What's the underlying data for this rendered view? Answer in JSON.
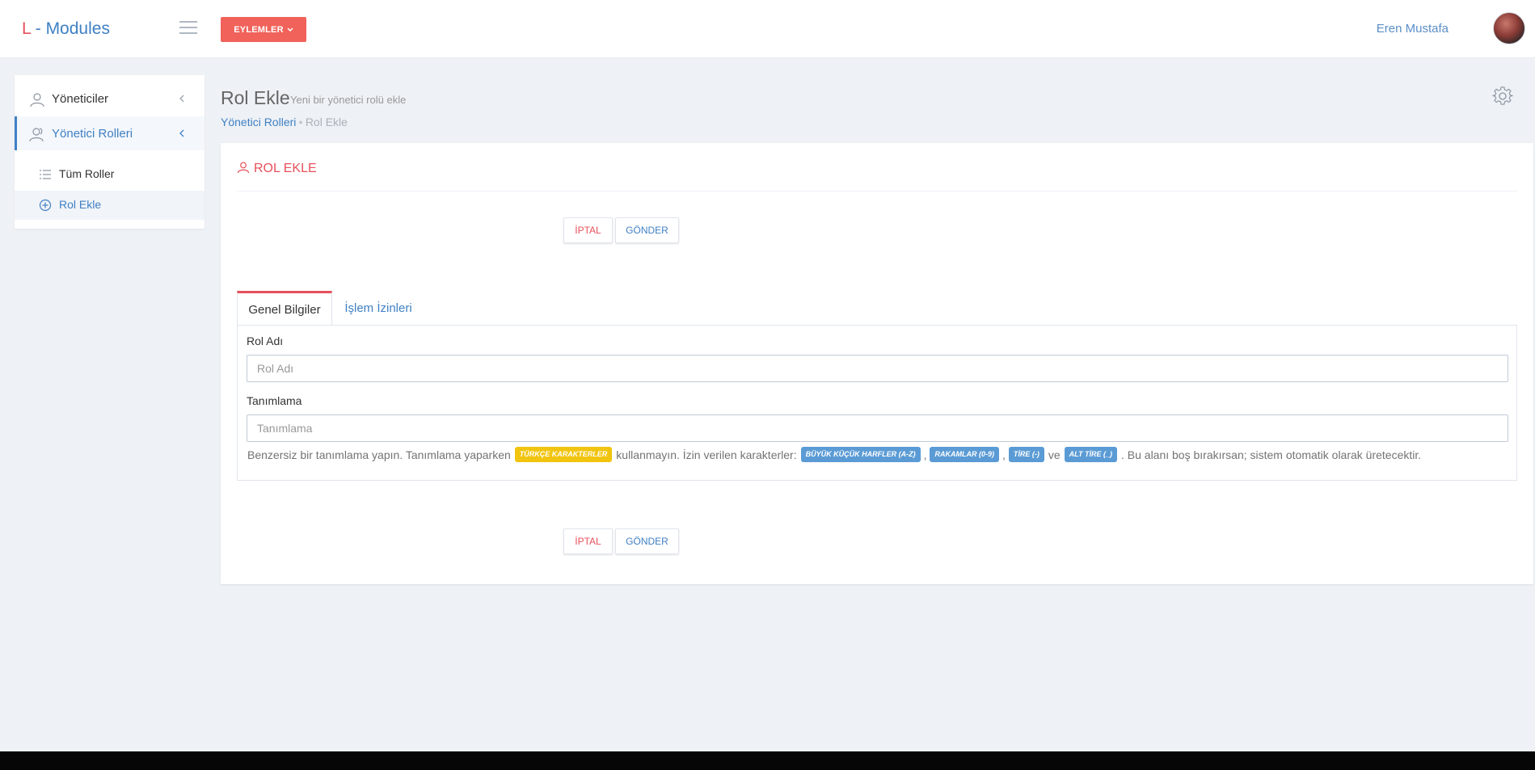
{
  "header": {
    "logo_l": "L",
    "logo_rest": " - Modules",
    "actions_label": "EYLEMLER",
    "user_name": "Eren Mustafa"
  },
  "sidebar": {
    "items": [
      {
        "label": "Yöneticiler",
        "icon": "user-icon"
      },
      {
        "label": "Yönetici Rolleri",
        "icon": "users-icon"
      }
    ],
    "subitems": [
      {
        "label": "Tüm Roller",
        "icon": "list-icon"
      },
      {
        "label": "Rol Ekle",
        "icon": "plus-circle-icon"
      }
    ]
  },
  "page": {
    "title": "Rol Ekle",
    "subtitle": "Yeni bir yönetici rolü ekle",
    "breadcrumb": {
      "parent": "Yönetici Rolleri",
      "current": "Rol Ekle"
    }
  },
  "portlet": {
    "title": "ROL EKLE",
    "cancel_label": "İPTAL",
    "send_label": "GÖNDER",
    "tabs": [
      {
        "label": "Genel Bilgiler"
      },
      {
        "label": "İşlem İzinleri"
      }
    ],
    "fields": {
      "role_name": {
        "label": "Rol Adı",
        "placeholder": "Rol Adı"
      },
      "slug": {
        "label": "Tanımlama",
        "placeholder": "Tanımlama"
      }
    },
    "help": {
      "part1": "Benzersiz bir tanımlama yapın. Tanımlama yaparken",
      "badge_turkish": "TÜRKÇE KARAKTERLER",
      "part2": "kullanmayın. İzin verilen karakterler:",
      "badge_letters": "BÜYÜK KÜÇÜK HARFLER (A-Z)",
      "comma1": ",",
      "badge_numbers": "RAKAMLAR (0-9)",
      "comma2": ",",
      "badge_dash": "TİRE (-)",
      "and": "ve",
      "badge_underscore": "ALT TİRE (_)",
      "part3": ". Bu alanı boş bırakırsan; sistem otomatik olarak üretecektir."
    }
  },
  "colors": {
    "brand_red": "#e7505a",
    "brand_blue": "#3f80c4",
    "action_button": "#f0625a",
    "badge_yellow": "#f1c40f",
    "badge_blue": "#5b9bd5"
  }
}
